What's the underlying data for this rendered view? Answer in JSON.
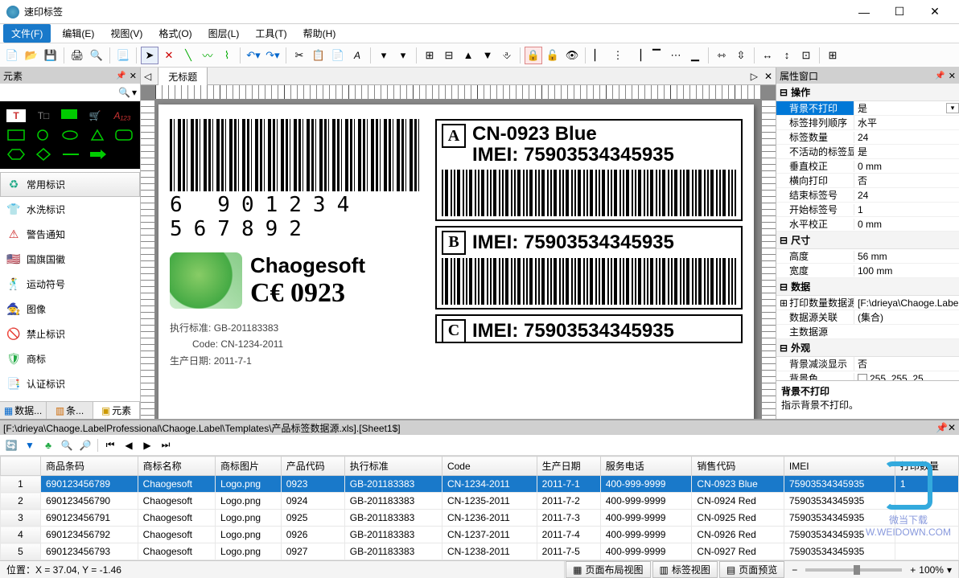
{
  "window": {
    "title": "速印标签"
  },
  "menu": {
    "file": "文件(F)",
    "items": [
      "编辑(E)",
      "视图(V)",
      "格式(O)",
      "图层(L)",
      "工具(T)",
      "帮助(H)"
    ]
  },
  "left": {
    "title": "元素",
    "cats": [
      {
        "icon": "♻",
        "color": "#2a8",
        "label": "常用标识",
        "active": true
      },
      {
        "icon": "👕",
        "color": "#06c",
        "label": "水洗标识"
      },
      {
        "icon": "⚠",
        "color": "#c22",
        "label": "警告通知"
      },
      {
        "icon": "🇺🇸",
        "color": "#06c",
        "label": "国旗国徽"
      },
      {
        "icon": "🕺",
        "color": "#06c",
        "label": "运动符号"
      },
      {
        "icon": "🧙",
        "color": "#642",
        "label": "图像"
      },
      {
        "icon": "🚫",
        "color": "#d33",
        "label": "禁止标识"
      },
      {
        "icon": "🛡",
        "color": "#2a4",
        "label": "商标"
      },
      {
        "icon": "📑",
        "color": "#888",
        "label": "认证标识"
      }
    ],
    "tabs": [
      "数据...",
      "条...",
      "元素"
    ]
  },
  "doc": {
    "tab": "无标题",
    "barcode_num": "6 901234 567892",
    "brand": "Chaogesoft",
    "ce": "C€ 0923",
    "spec1_k": "执行标准:",
    "spec1_v": "GB-201183383",
    "spec2_k": "Code:",
    "spec2_v": "CN-1234-2011",
    "spec3_k": "生产日期:",
    "spec3_v": "2011-7-1",
    "slotA": {
      "letter": "A",
      "line1": "CN-0923 Blue",
      "line2": "IMEI: 75903534345935"
    },
    "slotB": {
      "letter": "B",
      "line": "IMEI: 75903534345935"
    },
    "slotC": {
      "letter": "C",
      "line": "IMEI: 75903534345935"
    }
  },
  "props": {
    "title": "属性窗口",
    "sections": [
      {
        "name": "操作",
        "rows": [
          {
            "k": "背景不打印",
            "v": "是",
            "sel": true
          },
          {
            "k": "标签排列顺序",
            "v": "水平"
          },
          {
            "k": "标签数量",
            "v": "24"
          },
          {
            "k": "不活动的标签显示",
            "v": "是"
          },
          {
            "k": "垂直校正",
            "v": "0 mm"
          },
          {
            "k": "横向打印",
            "v": "否"
          },
          {
            "k": "结束标签号",
            "v": "24"
          },
          {
            "k": "开始标签号",
            "v": "1"
          },
          {
            "k": "水平校正",
            "v": "0 mm"
          }
        ]
      },
      {
        "name": "尺寸",
        "rows": [
          {
            "k": "高度",
            "v": "56 mm"
          },
          {
            "k": "宽度",
            "v": "100 mm"
          }
        ]
      },
      {
        "name": "数据",
        "rows": [
          {
            "k": "打印数量数据源",
            "v": "[F:\\drieya\\Chaoge.Label...",
            "expand": true
          },
          {
            "k": "数据源关联",
            "v": "(集合)"
          },
          {
            "k": "主数据源",
            "v": ""
          }
        ]
      },
      {
        "name": "外观",
        "rows": [
          {
            "k": "背景减淡显示",
            "v": "否"
          },
          {
            "k": "背景色",
            "v": "255, 255, 25",
            "color": true
          }
        ]
      }
    ],
    "desc_t": "背景不打印",
    "desc_b": "指示背景不打印。"
  },
  "dataPanel": {
    "path": "[F:\\drieya\\Chaoge.LabelProfessional\\Chaoge.Label\\Templates\\产品标签数据源.xls].[Sheet1$]",
    "cols": [
      "",
      "商品条码",
      "商标名称",
      "商标图片",
      "产品代码",
      "执行标准",
      "Code",
      "生产日期",
      "服务电话",
      "销售代码",
      "IMEI",
      "打印数量"
    ],
    "rows": [
      [
        "1",
        "690123456789",
        "Chaogesoft",
        "Logo.png",
        "0923",
        "GB-201183383",
        "CN-1234-2011",
        "2011-7-1",
        "400-999-9999",
        "CN-0923 Blue",
        "75903534345935",
        "1"
      ],
      [
        "2",
        "690123456790",
        "Chaogesoft",
        "Logo.png",
        "0924",
        "GB-201183383",
        "CN-1235-2011",
        "2011-7-2",
        "400-999-9999",
        "CN-0924 Red",
        "75903534345935",
        ""
      ],
      [
        "3",
        "690123456791",
        "Chaogesoft",
        "Logo.png",
        "0925",
        "GB-201183383",
        "CN-1236-2011",
        "2011-7-3",
        "400-999-9999",
        "CN-0925 Red",
        "75903534345935",
        ""
      ],
      [
        "4",
        "690123456792",
        "Chaogesoft",
        "Logo.png",
        "0926",
        "GB-201183383",
        "CN-1237-2011",
        "2011-7-4",
        "400-999-9999",
        "CN-0926 Red",
        "75903534345935",
        ""
      ],
      [
        "5",
        "690123456793",
        "Chaogesoft",
        "Logo.png",
        "0927",
        "GB-201183383",
        "CN-1238-2011",
        "2011-7-5",
        "400-999-9999",
        "CN-0927 Red",
        "75903534345935",
        ""
      ]
    ]
  },
  "status": {
    "pos": "位置：X = 37.04, Y = -1.46",
    "btns": [
      "页面布局视图",
      "标签视图",
      "页面预览"
    ],
    "zoom": "100%"
  },
  "watermark": {
    "name": "微当下载",
    "url": "W.WEIDOWN.COM"
  }
}
